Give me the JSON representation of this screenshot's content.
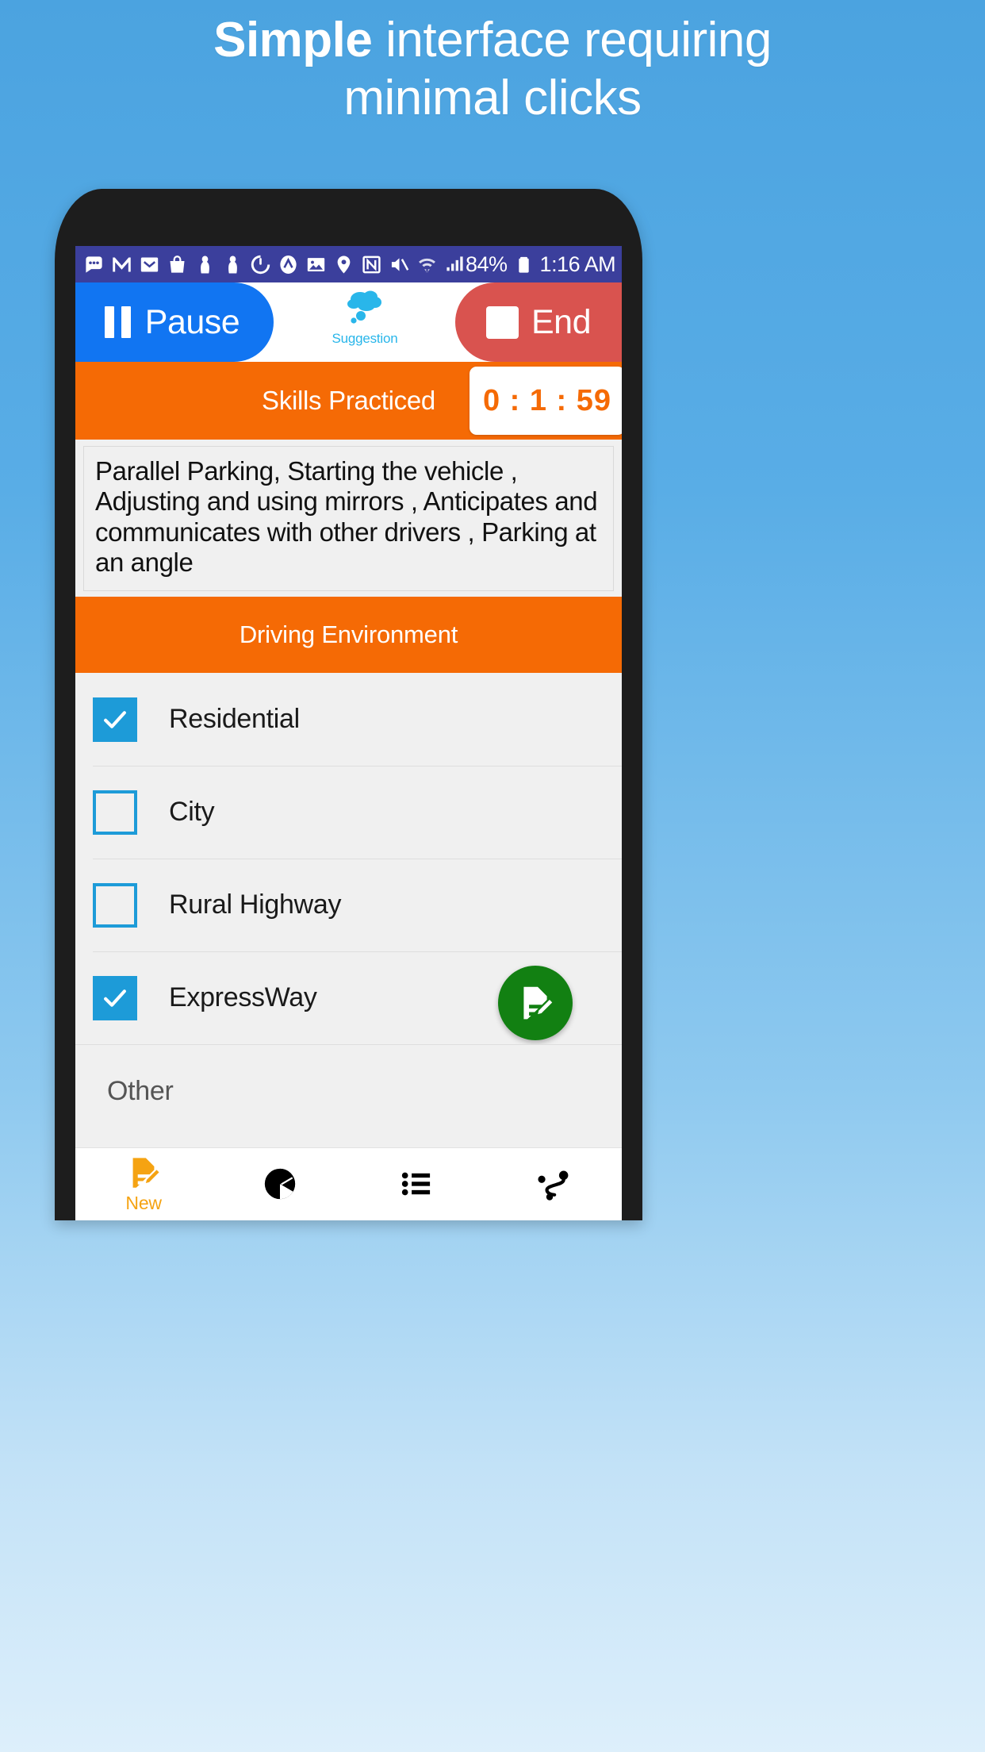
{
  "promo": {
    "headline_bold": "Simple",
    "headline_rest": " interface requiring",
    "headline_line2": "minimal clicks"
  },
  "status_bar": {
    "icons": [
      "messages-dots-icon",
      "gmail-icon",
      "email-envelope-icon",
      "shopping-bag-icon",
      "person-icon",
      "person-icon-2",
      "power-clock-icon",
      "adaway-icon",
      "photo-image-icon",
      "location-pin-icon",
      "nfc-icon",
      "mute-volume-icon",
      "wifi-transfer-icon",
      "cell-signal-icon"
    ],
    "battery_percent": "84%",
    "battery_icon": "battery-full-icon",
    "time": "1:16 AM",
    "background": "#3b3f9c"
  },
  "action_bar": {
    "pause_label": "Pause",
    "pause_icon": "pause-icon",
    "pause_color": "#1175f2",
    "suggestion_label": "Suggestion",
    "suggestion_icon": "thought-cloud-icon",
    "suggestion_color": "#29b6ea",
    "end_label": "End",
    "end_icon": "stop-square-icon",
    "end_color": "#d9534f"
  },
  "skills": {
    "header_title": "Skills Practiced",
    "timer": "0 : 1 : 59",
    "header_color": "#f56a05",
    "timer_color": "#f56a05",
    "text": "Parallel Parking, Starting the vehicle , Adjusting and using mirrors , Anticipates and communicates with other drivers , Parking at an angle"
  },
  "driving_environment": {
    "header_title": "Driving Environment",
    "header_color": "#f56a05",
    "checkbox_color": "#1d9bd8",
    "options": [
      {
        "label": "Residential",
        "checked": true
      },
      {
        "label": "City",
        "checked": false
      },
      {
        "label": "Rural Highway",
        "checked": false
      },
      {
        "label": "ExpressWay",
        "checked": true
      }
    ],
    "other_label": "Other",
    "fab": {
      "icon": "note-edit-icon",
      "color": "#128012"
    }
  },
  "bottom_nav": {
    "items": [
      {
        "label": "New",
        "icon": "note-edit-icon",
        "active": true
      },
      {
        "label": "",
        "icon": "pie-chart-icon",
        "active": false
      },
      {
        "label": "",
        "icon": "list-bullets-icon",
        "active": false
      },
      {
        "label": "",
        "icon": "route-path-icon",
        "active": false
      }
    ],
    "active_color": "#f5a312"
  }
}
